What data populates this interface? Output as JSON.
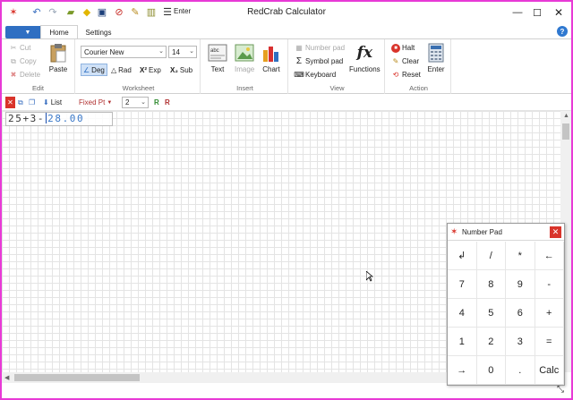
{
  "app": {
    "title": "RedCrab Calculator",
    "quick_access": {
      "enter_label": "Enter"
    }
  },
  "tabs": [
    {
      "label": "Home"
    },
    {
      "label": "Settings"
    }
  ],
  "ribbon": {
    "edit": {
      "label": "Edit",
      "cut": "Cut",
      "copy": "Copy",
      "delete": "Delete",
      "paste": "Paste"
    },
    "worksheet": {
      "label": "Worksheet",
      "font": "Courier New",
      "size": "14",
      "deg": "Deg",
      "rad": "Rad",
      "exp": "Exp",
      "sub": "Sub"
    },
    "insert": {
      "label": "Insert",
      "text": "Text",
      "image": "Image",
      "chart": "Chart"
    },
    "view": {
      "label": "View",
      "number_pad": "Number pad",
      "symbol_pad": "Symbol pad",
      "keyboard": "Keyboard",
      "functions": "Functions"
    },
    "action": {
      "label": "Action",
      "halt": "Halt",
      "clear": "Clear",
      "reset": "Reset",
      "enter": "Enter"
    }
  },
  "toolbar": {
    "list": "List",
    "format": "Fixed Pt",
    "precision": "2"
  },
  "worksheet": {
    "expression_before": "25+3-",
    "expression_after": "28.00"
  },
  "number_pad": {
    "title": "Number Pad",
    "keys": [
      "↲",
      "/",
      "*",
      "←",
      "7",
      "8",
      "9",
      "-",
      "4",
      "5",
      "6",
      "+",
      "1",
      "2",
      "3",
      "=",
      "→",
      "0",
      ".",
      "Calc"
    ]
  },
  "colors": {
    "window_border": "#e83ad6",
    "file_button": "#2f6fc2",
    "accent_red": "#d9342b"
  }
}
